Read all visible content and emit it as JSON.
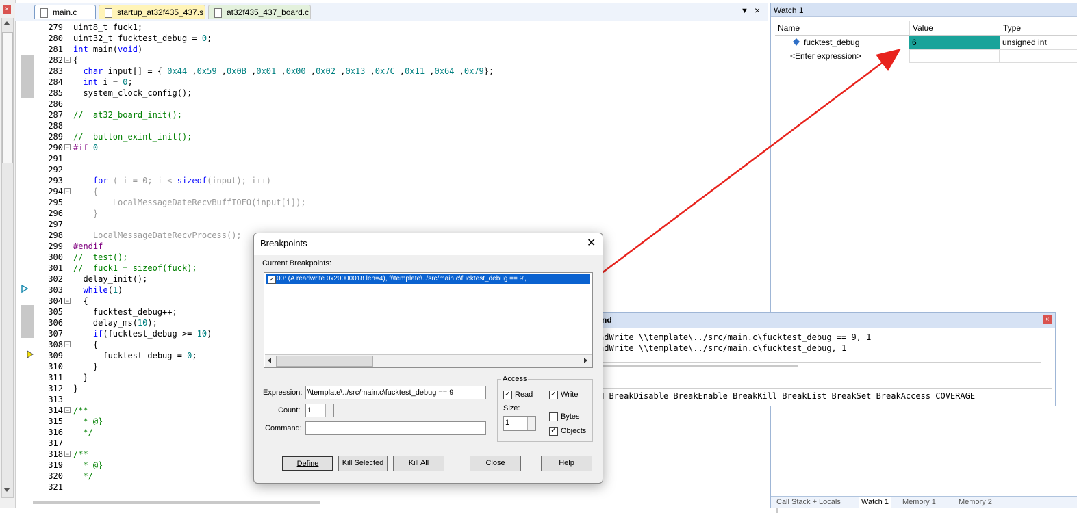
{
  "left_panel": {
    "close_glyph": "×"
  },
  "tabs": [
    {
      "label": "main.c",
      "active": true
    },
    {
      "label": "startup_at32f435_437.s",
      "active": false
    },
    {
      "label": "at32f435_437_board.c",
      "active": false
    }
  ],
  "tabbar": {
    "menu_glyph": "▼",
    "close_glyph": "×"
  },
  "editor": {
    "lines": [
      {
        "n": "279",
        "html": "uint8_t fuck1;"
      },
      {
        "n": "280",
        "html": "uint32_t fucktest_debug = <span class=\"num\">0</span>;"
      },
      {
        "n": "281",
        "html": "<span class=\"kw\">int</span> main(<span class=\"kw\">void</span>)"
      },
      {
        "n": "282",
        "html": "{",
        "fold": true
      },
      {
        "n": "283",
        "html": "  <span class=\"kw\">char</span> input[] = { <span class=\"num\">0x44</span> ,<span class=\"num\">0x59</span> ,<span class=\"num\">0x0B</span> ,<span class=\"num\">0x01</span> ,<span class=\"num\">0x00</span> ,<span class=\"num\">0x02</span> ,<span class=\"num\">0x13</span> ,<span class=\"num\">0x7C</span> ,<span class=\"num\">0x11</span> ,<span class=\"num\">0x64</span> ,<span class=\"num\">0x79</span>};"
      },
      {
        "n": "284",
        "html": "  <span class=\"kw\">int</span> i = <span class=\"num\">0</span>;"
      },
      {
        "n": "285",
        "html": "  system_clock_config();"
      },
      {
        "n": "286",
        "html": ""
      },
      {
        "n": "287",
        "html": "<span class=\"cm\">//  at32_board_init();</span>"
      },
      {
        "n": "288",
        "html": ""
      },
      {
        "n": "289",
        "html": "<span class=\"cm\">//  button_exint_init();</span>"
      },
      {
        "n": "290",
        "html": "<span class=\"pp\">#if</span> <span class=\"num\">0</span>",
        "fold": true
      },
      {
        "n": "291",
        "html": ""
      },
      {
        "n": "292",
        "html": ""
      },
      {
        "n": "293",
        "html": "    <span class=\"kw\">for</span><span class=\"dis\"> ( i = 0; i &lt; </span><span class=\"kw\">sizeof</span><span class=\"dis\">(input); i++)</span>"
      },
      {
        "n": "294",
        "html": "<span class=\"dis\">    {</span>",
        "fold": true
      },
      {
        "n": "295",
        "html": "<span class=\"dis\">        LocalMessageDateRecvBuffIOFO(input[i]);</span>"
      },
      {
        "n": "296",
        "html": "<span class=\"dis\">    }</span>"
      },
      {
        "n": "297",
        "html": ""
      },
      {
        "n": "298",
        "html": "<span class=\"dis\">    LocalMessageDateRecvProcess();</span>"
      },
      {
        "n": "299",
        "html": "<span class=\"pp\">#endif</span>"
      },
      {
        "n": "300",
        "html": "<span class=\"cm\">//  test();</span>"
      },
      {
        "n": "301",
        "html": "<span class=\"cm\">//  fuck1 = sizeof(fuck);</span>"
      },
      {
        "n": "302",
        "html": "  delay_init();"
      },
      {
        "n": "303",
        "html": "  <span class=\"kw\">while</span>(<span class=\"num\">1</span>)"
      },
      {
        "n": "304",
        "html": "  {",
        "fold": true
      },
      {
        "n": "305",
        "html": "    fucktest_debug++;"
      },
      {
        "n": "306",
        "html": "    delay_ms(<span class=\"num\">10</span>);"
      },
      {
        "n": "307",
        "html": "    <span class=\"kw\">if</span>(fucktest_debug &gt;= <span class=\"num\">10</span>)"
      },
      {
        "n": "308",
        "html": "    {",
        "fold": true
      },
      {
        "n": "309",
        "html": "      fucktest_debug = <span class=\"num\">0</span>;"
      },
      {
        "n": "310",
        "html": "    }"
      },
      {
        "n": "311",
        "html": "  }"
      },
      {
        "n": "312",
        "html": "}"
      },
      {
        "n": "313",
        "html": ""
      },
      {
        "n": "314",
        "html": "<span class=\"cm\">/**</span>",
        "fold": true
      },
      {
        "n": "315",
        "html": "<span class=\"cm\">  * @}</span>"
      },
      {
        "n": "316",
        "html": "<span class=\"cm\">  */</span>"
      },
      {
        "n": "317",
        "html": ""
      },
      {
        "n": "318",
        "html": "<span class=\"cm\">/**</span>",
        "fold": true
      },
      {
        "n": "319",
        "html": "<span class=\"cm\">  * @}</span>"
      },
      {
        "n": "320",
        "html": "<span class=\"cm\">  */</span>"
      },
      {
        "n": "321",
        "html": ""
      }
    ]
  },
  "watch": {
    "title": "Watch 1",
    "columns": [
      "Name",
      "Value",
      "Type"
    ],
    "rows": [
      {
        "name": "fucktest_debug",
        "value": "6",
        "type": "unsigned int"
      },
      {
        "name": "<Enter expression>",
        "value": "",
        "type": ""
      }
    ],
    "value_highlight": "#1aa39a",
    "tabs": [
      "Call Stack + Locals",
      "Watch 1",
      "Memory 1",
      "Memory 2"
    ]
  },
  "command": {
    "title_fragment": "nd",
    "close_glyph": "×",
    "output": [
      "adWrite \\\\template\\../src/main.c\\fucktest_debug == 9, 1",
      "adWrite \\\\template\\../src/main.c\\fucktest_debug, 1"
    ],
    "hint": "N BreakDisable BreakEnable BreakKill BreakList BreakSet BreakAccess COVERAGE"
  },
  "dialog": {
    "title": "Breakpoints",
    "close_glyph": "✕",
    "current_label": "Current Breakpoints:",
    "breakpoint": "00: (A readwrite 0x20000018 len=4),  '\\\\template\\../src/main.c\\fucktest_debug == 9',",
    "expression_label": "Expression:",
    "expression_value": "\\\\template\\../src/main.c\\fucktest_debug == 9",
    "count_label": "Count:",
    "count_value": "1",
    "command_label": "Command:",
    "command_value": "",
    "access_label": "Access",
    "read_label": "Read",
    "write_label": "Write",
    "size_label": "Size:",
    "size_value": "1",
    "bytes_label": "Bytes",
    "objects_label": "Objects",
    "read_checked": true,
    "write_checked": true,
    "bytes_checked": false,
    "objects_checked": true,
    "buttons": {
      "define": "Define",
      "kill_selected": "Kill Selected",
      "kill_all": "Kill All",
      "close": "Close",
      "help": "Help"
    }
  },
  "arrow_color": "#e8231d"
}
